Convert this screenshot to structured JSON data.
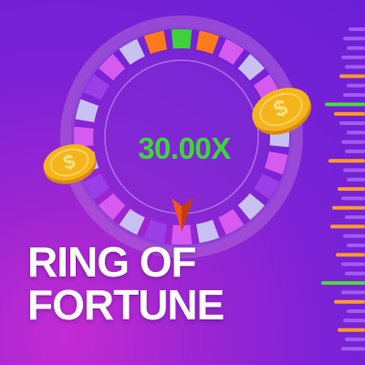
{
  "game": {
    "title_line1": "RING OF",
    "title_line2": "FORTUNE",
    "multiplier": "30.00X"
  },
  "colors": {
    "multiplier": "#3dd63a",
    "pointer": "#f0541a",
    "coin": "#f5b41c",
    "coin_dark": "#d9880e",
    "ring_outer": "#b06ad9",
    "segment_pink": "#d65af0",
    "segment_purple": "#9a3ee8",
    "segment_lavender": "#c7c2f2",
    "segment_orange": "#ff7a1c",
    "segment_green": "#3ed23a",
    "bar_purple": "#a15cf0",
    "bar_orange": "#ff9a2a",
    "bar_green": "#4fd840"
  },
  "icons": {
    "pointer": "pointer-arrow-icon",
    "coin": "dollar-coin-icon"
  }
}
